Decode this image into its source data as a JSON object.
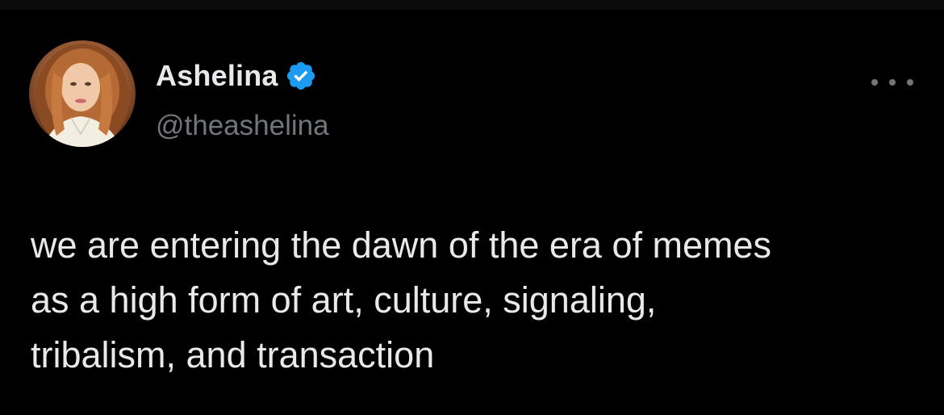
{
  "theme": {
    "background": "#000000",
    "text_primary": "#e7e9ea",
    "text_secondary": "#71767b",
    "verified_badge": "#1d9bf0"
  },
  "author": {
    "display_name": "Ashelina",
    "handle": "@theashelina",
    "verified": true,
    "avatar_icon": "profile-photo"
  },
  "tweet": {
    "text": "we are entering the dawn of the era of memes\nas a high form of art, culture, signaling,\ntribalism, and transaction"
  },
  "icons": {
    "more": "more-horizontal-icon",
    "verified": "verified-badge-icon"
  }
}
